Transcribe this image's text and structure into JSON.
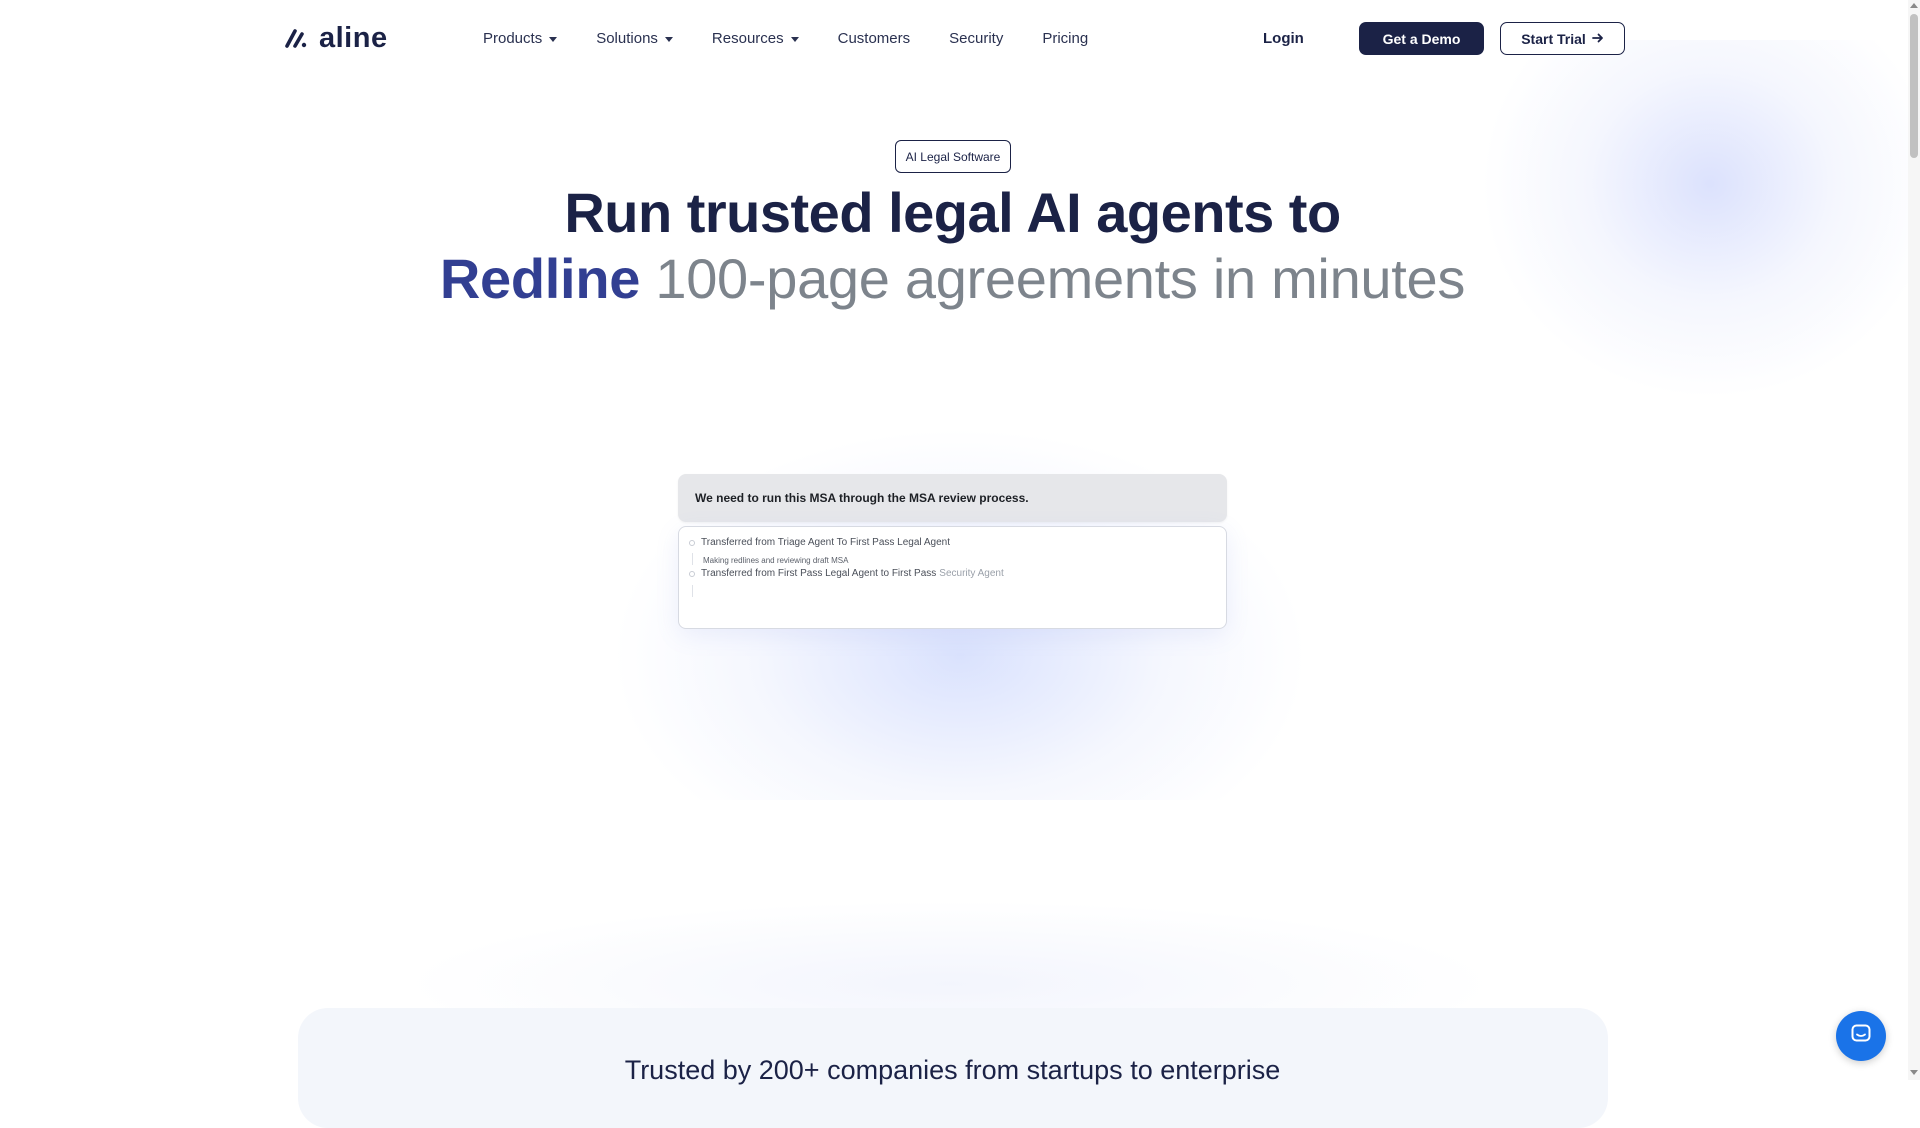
{
  "brand": {
    "name": "aline",
    "logo_icon": "slash-mark-logo-icon"
  },
  "nav": {
    "items": [
      {
        "label": "Products",
        "has_dropdown": true
      },
      {
        "label": "Solutions",
        "has_dropdown": true
      },
      {
        "label": "Resources",
        "has_dropdown": true
      },
      {
        "label": "Customers",
        "has_dropdown": false
      },
      {
        "label": "Security",
        "has_dropdown": false
      },
      {
        "label": "Pricing",
        "has_dropdown": false
      }
    ],
    "login_label": "Login",
    "demo_label": "Get a Demo",
    "trial_label": "Start Trial"
  },
  "hero": {
    "badge": "AI Legal Software",
    "headline_line1": "Run trusted legal AI agents to",
    "headline_accent": "Redline",
    "headline_rest": "100-page agreements in minutes"
  },
  "demo": {
    "prompt": "We need to run this MSA through the MSA review process.",
    "log": [
      "Transferred from Triage Agent To First Pass Legal Agent",
      "Making redlines and reviewing draft MSA",
      "Transferred from First Pass Legal Agent to First Pass",
      "Security Agent"
    ]
  },
  "trust": {
    "title": "Trusted by 200+ companies from startups to enterprise"
  },
  "chat": {
    "icon": "chat-bubble-icon"
  },
  "colors": {
    "navy": "#1b2246",
    "accent": "#323f92",
    "muted": "#7d848c",
    "chat_blue": "#1a73e8"
  }
}
